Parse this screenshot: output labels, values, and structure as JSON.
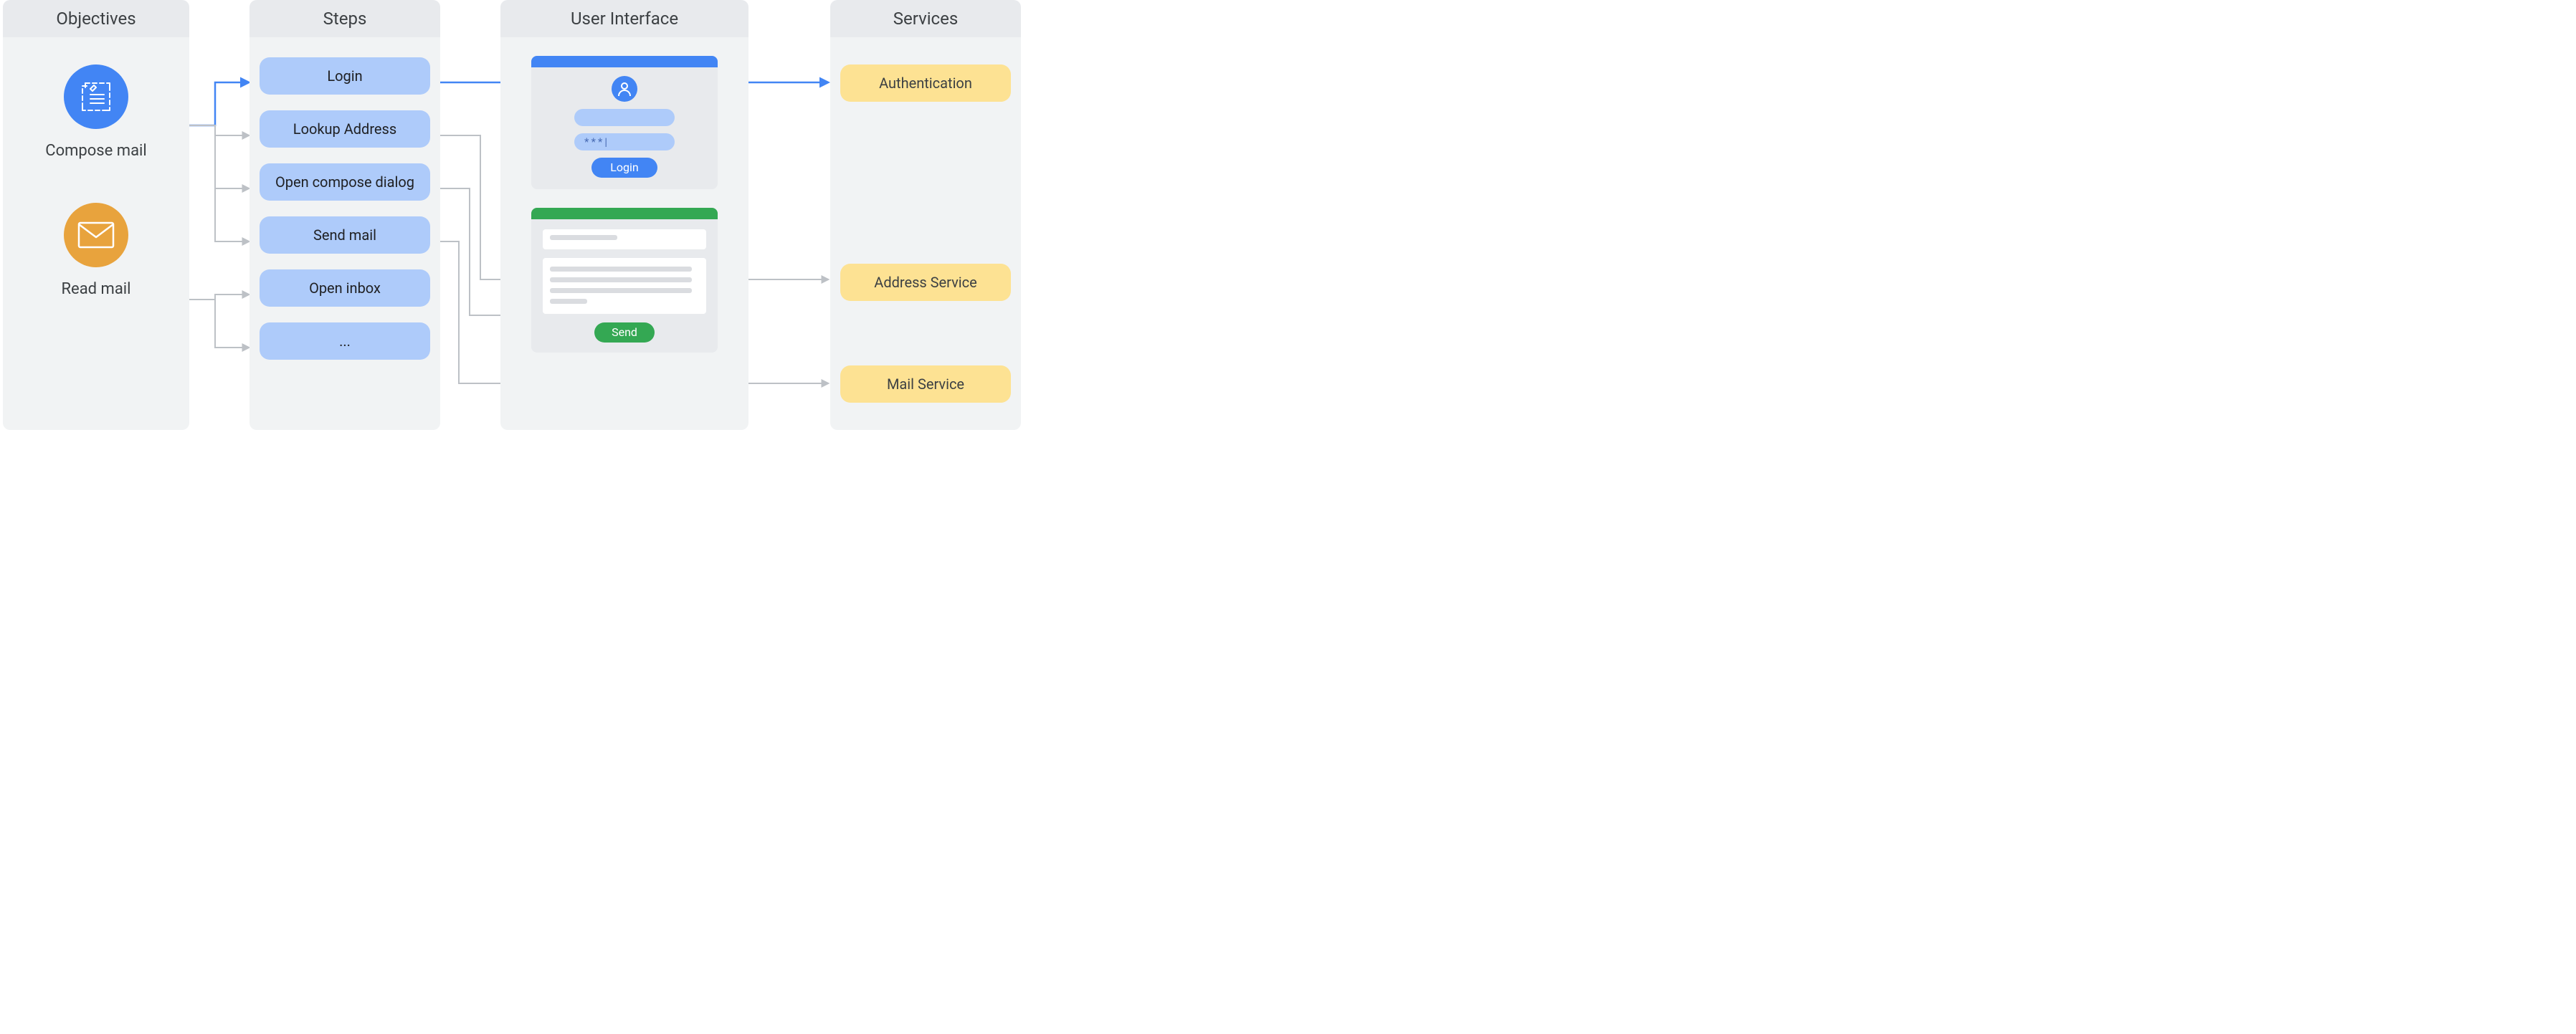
{
  "columns": {
    "objectives": {
      "header": "Objectives"
    },
    "steps": {
      "header": "Steps"
    },
    "ui": {
      "header": "User Interface"
    },
    "services": {
      "header": "Services"
    }
  },
  "objectives": [
    {
      "label": "Compose mail",
      "color": "#4285F4",
      "icon": "compose-document-icon"
    },
    {
      "label": "Read mail",
      "color": "#E8A33D",
      "icon": "envelope-icon"
    }
  ],
  "steps": [
    {
      "label": "Login"
    },
    {
      "label": "Lookup Address"
    },
    {
      "label": "Open compose dialog"
    },
    {
      "label": "Send mail"
    },
    {
      "label": "Open inbox"
    },
    {
      "label": "..."
    }
  ],
  "ui": {
    "login": {
      "password_mask": "***|",
      "button": "Login"
    },
    "compose": {
      "button": "Send"
    }
  },
  "services": [
    {
      "label": "Authentication"
    },
    {
      "label": "Address Service"
    },
    {
      "label": "Mail Service"
    }
  ],
  "arrow_colors": {
    "primary": "#4285F4",
    "secondary": "#BDC1C6"
  }
}
